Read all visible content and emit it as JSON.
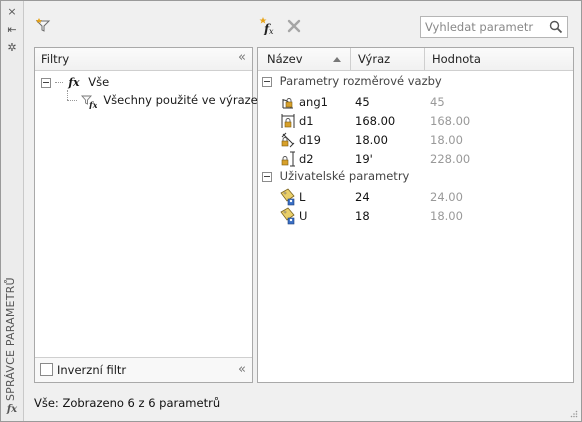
{
  "sidebar": {
    "title": "SPRÁVCE PARAMETRŮ",
    "close_glyph": "×",
    "autohide_glyph": "⇤",
    "properties_glyph": "✲",
    "fx_glyph": "fx"
  },
  "toolbar": {
    "filter_icon": "create-filter-icon",
    "new_param_icon": "new-user-parameter-icon",
    "delete_icon": "delete-parameter-icon",
    "search_placeholder": "Vyhledat parametr"
  },
  "filters_panel": {
    "header": "Filtry",
    "collapse_glyph": "«",
    "tree": [
      {
        "label": "Vše",
        "glyph": "fx"
      },
      {
        "label": "Všechny použité ve výrazech",
        "glyph": "fx"
      }
    ],
    "invert_label": "Inverzní filtr"
  },
  "params_panel": {
    "columns": [
      "Název",
      "Výraz",
      "Hodnota"
    ],
    "groups": [
      {
        "label": "Parametry rozměrové vazby",
        "rows": [
          {
            "name": "ang1",
            "expr": "45",
            "value": "45",
            "icon": "angular-dimension-icon"
          },
          {
            "name": "d1",
            "expr": "168.00",
            "value": "168.00",
            "icon": "horizontal-dimension-icon"
          },
          {
            "name": "d19",
            "expr": "18.00",
            "value": "18.00",
            "icon": "aligned-dimension-icon"
          },
          {
            "name": "d2",
            "expr": "19'",
            "value": "228.00",
            "icon": "vertical-dimension-icon"
          }
        ]
      },
      {
        "label": "Uživatelské parametry",
        "rows": [
          {
            "name": "L",
            "expr": "24",
            "value": "24.00",
            "icon": "user-parameter-icon"
          },
          {
            "name": "U",
            "expr": "18",
            "value": "18.00",
            "icon": "user-parameter-icon"
          }
        ]
      }
    ]
  },
  "status": "Vše: Zobrazeno 6 z 6 parametrů",
  "colors": {
    "accent_orange": "#e8a317",
    "lock_gold": "#d7a02a",
    "user_param_blue": "#3a6fc4"
  }
}
